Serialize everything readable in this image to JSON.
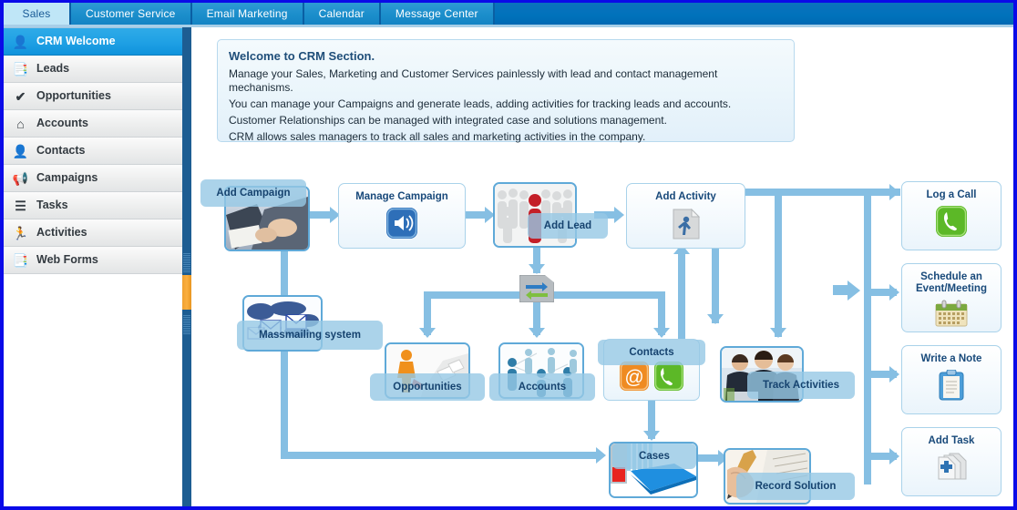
{
  "app": {
    "accent_blue": "#0072bb",
    "frame_blue": "#0a0ae8",
    "active_tab_bg": "#bfe6f7",
    "connector_blue": "#86bfe3",
    "node_title_color": "#18497a"
  },
  "tabs": [
    {
      "label": "Sales",
      "active": true
    },
    {
      "label": "Customer Service",
      "active": false
    },
    {
      "label": "Email Marketing",
      "active": false
    },
    {
      "label": "Calendar",
      "active": false
    },
    {
      "label": "Message Center",
      "active": false
    }
  ],
  "sidebar": {
    "items": [
      {
        "label": "CRM Welcome",
        "icon": "user-card-icon",
        "glyph": "👤",
        "active": true
      },
      {
        "label": "Leads",
        "icon": "documents-icon",
        "glyph": "📑",
        "active": false
      },
      {
        "label": "Opportunities",
        "icon": "checkmark-icon",
        "glyph": "✔",
        "active": false
      },
      {
        "label": "Accounts",
        "icon": "house-icon",
        "glyph": "⌂",
        "active": false
      },
      {
        "label": "Contacts",
        "icon": "person-bust-icon",
        "glyph": "👤",
        "active": false
      },
      {
        "label": "Campaigns",
        "icon": "megaphone-icon",
        "glyph": "📢",
        "active": false
      },
      {
        "label": "Tasks",
        "icon": "list-lines-icon",
        "glyph": "☰",
        "active": false
      },
      {
        "label": "Activities",
        "icon": "running-person-icon",
        "glyph": "🏃",
        "active": false
      },
      {
        "label": "Web Forms",
        "icon": "form-pages-icon",
        "glyph": "📑",
        "active": false
      }
    ],
    "scrollbar": {
      "name": "sidebar-scrollbar",
      "thumb_color": "#fbb040"
    }
  },
  "welcome": {
    "title": "Welcome to CRM Section.",
    "lines": [
      "Manage your Sales, Marketing and Customer Services painlessly with lead and contact management mechanisms.",
      "You can manage your Campaigns and generate leads, adding activities for tracking leads and accounts.",
      "Customer Relationships can be managed with integrated case and solutions management.",
      "CRM allows sales managers to track all sales and marketing activities in the company."
    ]
  },
  "flow": {
    "nodes": [
      {
        "id": "add-campaign",
        "label": "Add Campaign",
        "kind": "photo",
        "icon": "business-meeting-photo"
      },
      {
        "id": "manage-campaign",
        "label": "Manage Campaign",
        "kind": "card",
        "icon": "megaphone-speaker-icon"
      },
      {
        "id": "add-lead",
        "label": "Add Lead",
        "kind": "photo",
        "icon": "crowd-red-figure-photo"
      },
      {
        "id": "add-activity",
        "label": "Add Activity",
        "kind": "card",
        "icon": "walking-person-page-icon"
      },
      {
        "id": "log-a-call",
        "label": "Log a Call",
        "kind": "card",
        "icon": "green-phone-icon"
      },
      {
        "id": "schedule-event",
        "label": "Schedule an\nEvent/Meeting",
        "kind": "card",
        "icon": "calendar-icon"
      },
      {
        "id": "write-a-note",
        "label": "Write a Note",
        "kind": "card",
        "icon": "clipboard-note-icon"
      },
      {
        "id": "add-task",
        "label": "Add Task",
        "kind": "card",
        "icon": "add-pages-plus-icon"
      },
      {
        "id": "massmailing",
        "label": "Massmailing system",
        "kind": "photo",
        "icon": "world-envelopes-photo"
      },
      {
        "id": "opportunities",
        "label": "Opportunities",
        "kind": "photo",
        "icon": "orange-figure-chart-photo"
      },
      {
        "id": "accounts",
        "label": "Accounts",
        "kind": "photo",
        "icon": "network-people-photo"
      },
      {
        "id": "contacts",
        "label": "Contacts",
        "kind": "card",
        "icon": "at-sign-and-phone-icon"
      },
      {
        "id": "track-activities",
        "label": "Track Activities",
        "kind": "photo",
        "icon": "team-laptop-photo"
      },
      {
        "id": "cases",
        "label": "Cases",
        "kind": "photo",
        "icon": "blue-book-folder-photo"
      },
      {
        "id": "record-solution",
        "label": "Record Solution",
        "kind": "photo",
        "icon": "hand-writing-photo"
      },
      {
        "id": "convert",
        "label": "",
        "kind": "badge",
        "icon": "convert-exchange-arrows-icon"
      }
    ]
  }
}
